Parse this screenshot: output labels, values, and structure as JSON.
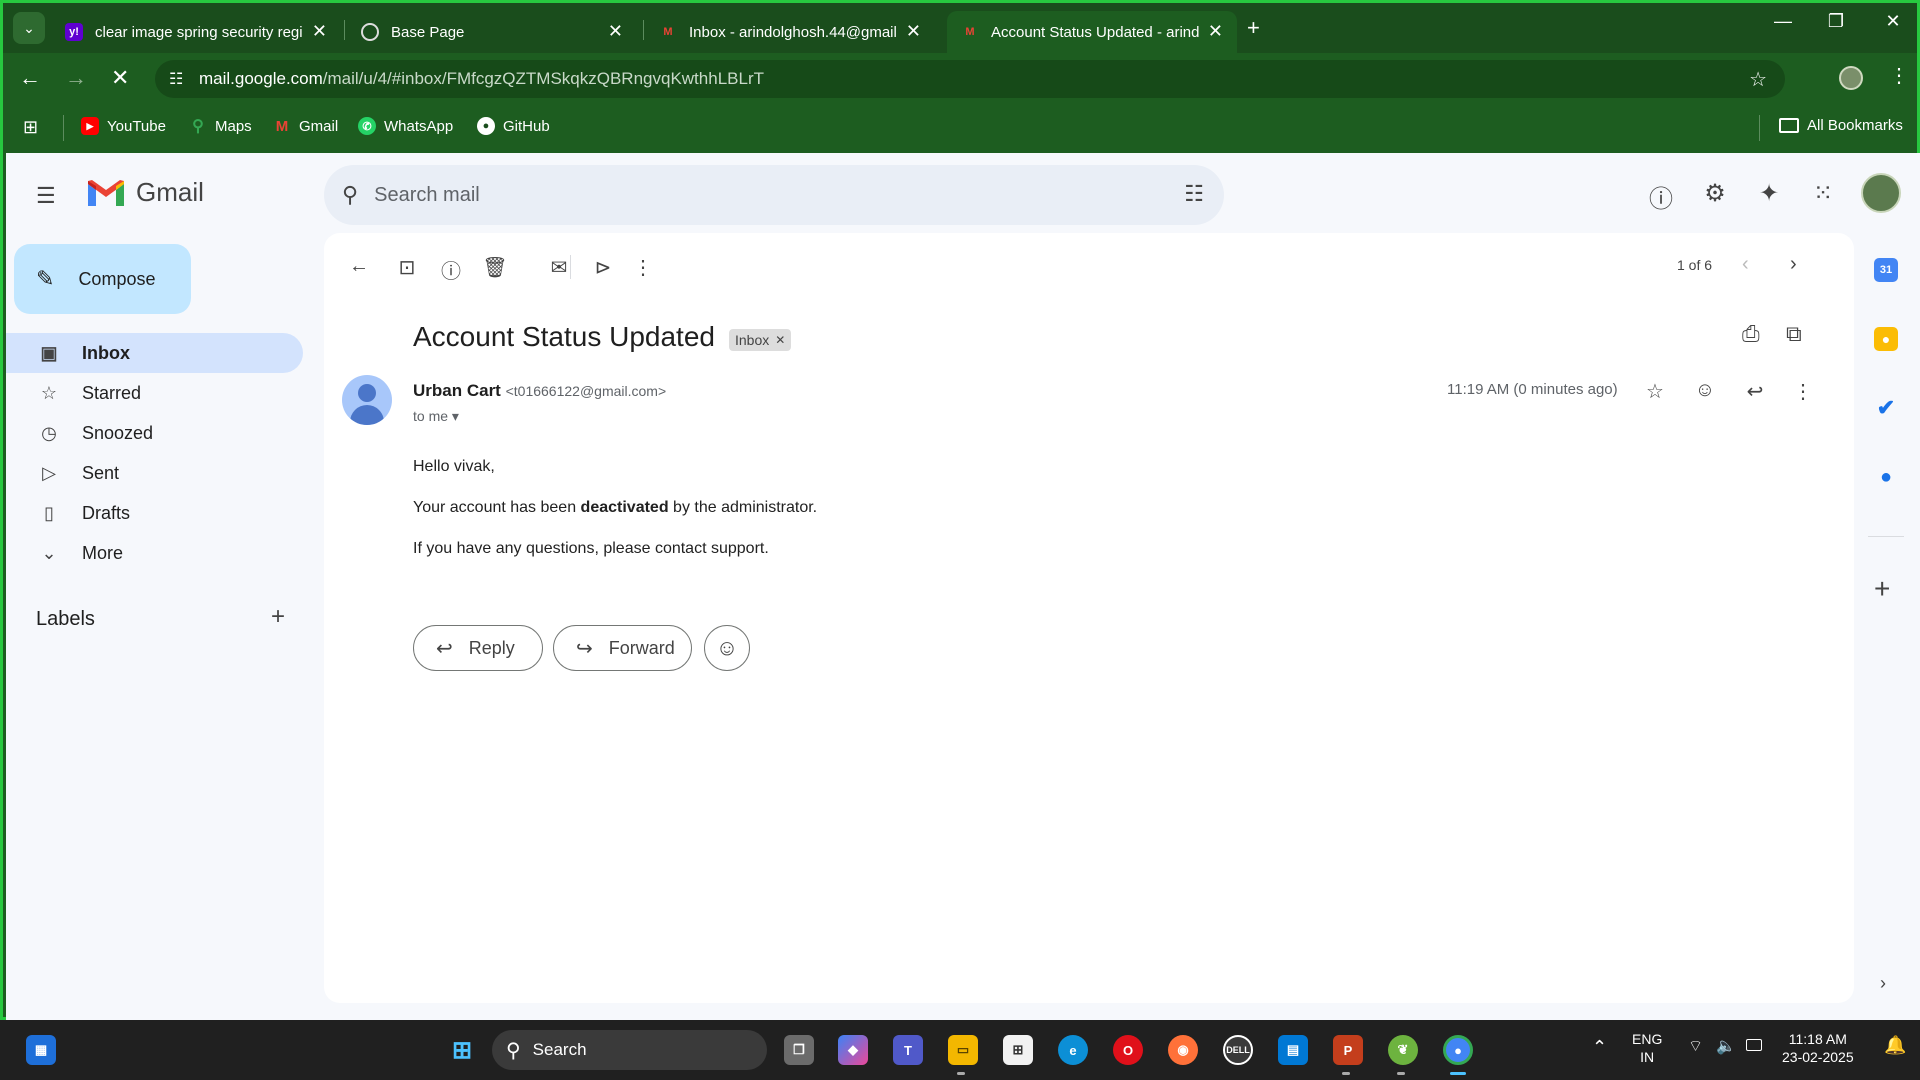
{
  "browser": {
    "tabs": [
      {
        "title": "clear image spring security regi",
        "favicon": "y!",
        "favicon_color": "#5f01d1"
      },
      {
        "title": "Base Page",
        "favicon": "globe-icon",
        "favicon_color": "#3a7a3c"
      },
      {
        "title": "Inbox - arindolghosh.44@gmail",
        "favicon": "M",
        "favicon_color": "#ffffff"
      },
      {
        "title": "Account Status Updated - arind",
        "favicon": "M",
        "favicon_color": "#ffffff"
      }
    ],
    "url_host": "mail.google.com",
    "url_path": "/mail/u/4/#inbox/FMfcgzQZTMSkqkzQBRngvqKwthhLBLrT",
    "bookmarks": [
      {
        "label": "YouTube",
        "color": "#ff0000",
        "glyph": "▶"
      },
      {
        "label": "Maps",
        "color": "#34a853",
        "glyph": "⚲"
      },
      {
        "label": "Gmail",
        "color": "#ea4335",
        "glyph": "M"
      },
      {
        "label": "WhatsApp",
        "color": "#25d366",
        "glyph": "✆"
      },
      {
        "label": "GitHub",
        "color": "#ffffff",
        "glyph": "●"
      }
    ],
    "all_bookmarks": "All Bookmarks"
  },
  "gmail": {
    "app_name": "Gmail",
    "search_placeholder": "Search mail",
    "compose": "Compose",
    "nav": [
      {
        "label": "Inbox",
        "icon": "inbox-icon",
        "glyph": "▣",
        "active": true
      },
      {
        "label": "Starred",
        "icon": "star-icon",
        "glyph": "☆",
        "active": false
      },
      {
        "label": "Snoozed",
        "icon": "clock-icon",
        "glyph": "◷",
        "active": false
      },
      {
        "label": "Sent",
        "icon": "send-icon",
        "glyph": "▷",
        "active": false
      },
      {
        "label": "Drafts",
        "icon": "draft-icon",
        "glyph": "▯",
        "active": false
      },
      {
        "label": "More",
        "icon": "chevron-down-icon",
        "glyph": "⌄",
        "active": false
      }
    ],
    "labels_heading": "Labels",
    "pager": "1 of 6",
    "email": {
      "subject": "Account Status Updated",
      "label_chip": "Inbox",
      "sender_name": "Urban Cart",
      "sender_email": "<t01666122@gmail.com>",
      "recipient": "to me",
      "time": "11:19 AM (0 minutes ago)",
      "greeting": "Hello vivak,",
      "line1_pre": "Your account has been ",
      "line1_bold": "deactivated",
      "line1_post": " by the administrator.",
      "line2": "If you have any questions, please contact support."
    },
    "reply": "Reply",
    "forward": "Forward"
  },
  "taskbar": {
    "search": "Search",
    "lang_top": "ENG",
    "lang_bottom": "IN",
    "time": "11:18 AM",
    "date": "23-02-2025"
  }
}
